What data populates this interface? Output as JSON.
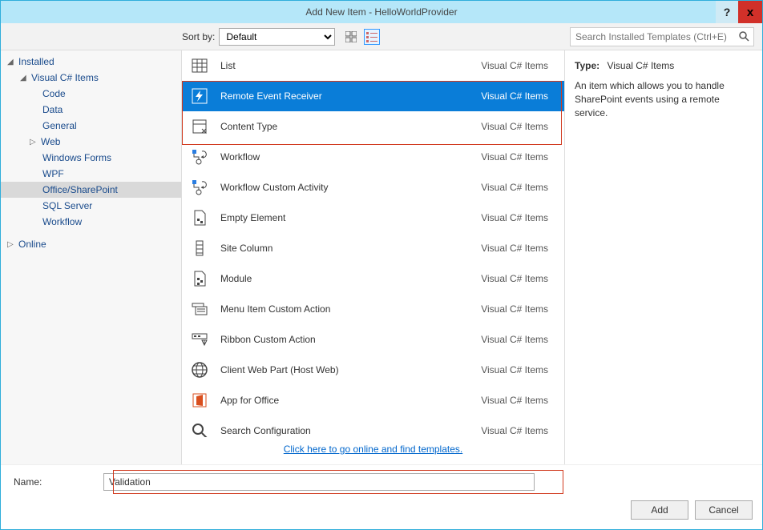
{
  "titlebar": {
    "title": "Add New Item - HelloWorldProvider",
    "help": "?",
    "close": "x"
  },
  "toolbar": {
    "sort_label": "Sort by:",
    "sort_value": "Default",
    "search_placeholder": "Search Installed Templates (Ctrl+E)"
  },
  "tree": {
    "installed": "Installed",
    "csharp": "Visual C# Items",
    "leaves": [
      "Code",
      "Data",
      "General",
      "Web",
      "Windows Forms",
      "WPF",
      "Office/SharePoint",
      "SQL Server",
      "Workflow"
    ],
    "selected_leaf_index": 6,
    "web_expandable": true,
    "online": "Online"
  },
  "items": [
    {
      "label": "List",
      "cat": "Visual C# Items",
      "icon": "list"
    },
    {
      "label": "Remote Event Receiver",
      "cat": "Visual C# Items",
      "icon": "bolt",
      "selected": true
    },
    {
      "label": "Content Type",
      "cat": "Visual C# Items",
      "icon": "content"
    },
    {
      "label": "Workflow",
      "cat": "Visual C# Items",
      "icon": "workflow"
    },
    {
      "label": "Workflow Custom Activity",
      "cat": "Visual C# Items",
      "icon": "workflow"
    },
    {
      "label": "Empty Element",
      "cat": "Visual C# Items",
      "icon": "empty"
    },
    {
      "label": "Site Column",
      "cat": "Visual C# Items",
      "icon": "column"
    },
    {
      "label": "Module",
      "cat": "Visual C# Items",
      "icon": "module"
    },
    {
      "label": "Menu Item Custom Action",
      "cat": "Visual C# Items",
      "icon": "menu"
    },
    {
      "label": "Ribbon Custom Action",
      "cat": "Visual C# Items",
      "icon": "ribbon"
    },
    {
      "label": "Client Web Part (Host Web)",
      "cat": "Visual C# Items",
      "icon": "globe"
    },
    {
      "label": "App for Office",
      "cat": "Visual C# Items",
      "icon": "office"
    },
    {
      "label": "Search Configuration",
      "cat": "Visual C# Items",
      "icon": "search"
    }
  ],
  "link_text": "Click here to go online and find templates.",
  "desc": {
    "type_label": "Type:",
    "type_value": "Visual C# Items",
    "text": "An item which allows you to handle SharePoint events using a remote service."
  },
  "name_row": {
    "label": "Name:",
    "value": "Validation"
  },
  "buttons": {
    "add": "Add",
    "cancel": "Cancel"
  }
}
